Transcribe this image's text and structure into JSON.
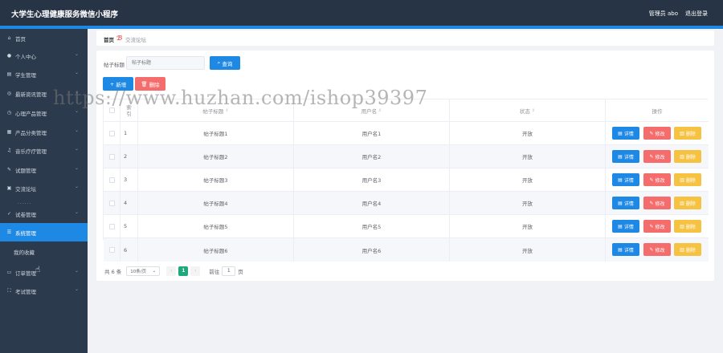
{
  "header": {
    "title": "大学生心理健康服务微信小程序",
    "admin_label": "管理员 abo",
    "logout_label": "退出登录"
  },
  "sidebar": {
    "items": [
      {
        "label": "首页",
        "icon": "home-icon",
        "has_arrow": false,
        "active": false
      },
      {
        "label": "个人中心",
        "icon": "user-icon",
        "has_arrow": true,
        "active": false
      },
      {
        "label": "学生管理",
        "icon": "student-icon",
        "has_arrow": true,
        "active": false
      },
      {
        "label": "最新资讯管理",
        "icon": "news-icon",
        "has_arrow": true,
        "active": false
      },
      {
        "label": "心理产品管理",
        "icon": "product-icon",
        "has_arrow": true,
        "active": false
      },
      {
        "label": "产品分类管理",
        "icon": "category-icon",
        "has_arrow": true,
        "active": false
      },
      {
        "label": "音乐疗疗管理",
        "icon": "music-icon",
        "has_arrow": true,
        "active": false
      },
      {
        "label": "试题管理",
        "icon": "exam-icon",
        "has_arrow": true,
        "active": false
      },
      {
        "label": "交流论坛",
        "icon": "forum-icon",
        "has_arrow": true,
        "active": false
      },
      {
        "label": "试卷管理",
        "icon": "paper-icon",
        "has_arrow": true,
        "active": false
      },
      {
        "label": "系统管理",
        "icon": "system-icon",
        "has_arrow": false,
        "active": true
      },
      {
        "label": "订单管理",
        "icon": "order-icon",
        "has_arrow": true,
        "active": false
      },
      {
        "label": "考试管理",
        "icon": "test-icon",
        "has_arrow": true,
        "active": false
      }
    ],
    "submenu_label": "我的收藏",
    "dots": "······"
  },
  "breadcrumb": {
    "home": "首页",
    "current": "交流论坛"
  },
  "search": {
    "label": "帖子标题",
    "placeholder": "帖子标题",
    "query_label": "查询"
  },
  "actions": {
    "add_label": "新增",
    "delete_label": "删除"
  },
  "table": {
    "headers": {
      "index_top": "索",
      "index_bottom": "引",
      "title": "帖子标题",
      "user": "用户名",
      "status": "状态",
      "ops": "操作"
    },
    "rows": [
      {
        "index": "1",
        "title": "帖子标题1",
        "user": "用户名1",
        "status": "开放"
      },
      {
        "index": "2",
        "title": "帖子标题2",
        "user": "用户名2",
        "status": "开放"
      },
      {
        "index": "3",
        "title": "帖子标题3",
        "user": "用户名3",
        "status": "开放"
      },
      {
        "index": "4",
        "title": "帖子标题4",
        "user": "用户名4",
        "status": "开放"
      },
      {
        "index": "5",
        "title": "帖子标题5",
        "user": "用户名5",
        "status": "开放"
      },
      {
        "index": "6",
        "title": "帖子标题6",
        "user": "用户名6",
        "status": "开放"
      }
    ],
    "row_buttons": {
      "detail": "详情",
      "edit": "修改",
      "delete": "删除"
    }
  },
  "pagination": {
    "total": "共 6 条",
    "page_size": "10条/页",
    "current_page": "1",
    "goto_label": "前往",
    "goto_value": "1",
    "page_unit": "页"
  },
  "watermark": "https://www.huzhan.com/ishop39397",
  "colors": {
    "topbar": "#263445",
    "accent": "#1e88e5",
    "danger": "#f56c6c",
    "warning": "#f5c242",
    "pager_active": "#1ea97c"
  }
}
